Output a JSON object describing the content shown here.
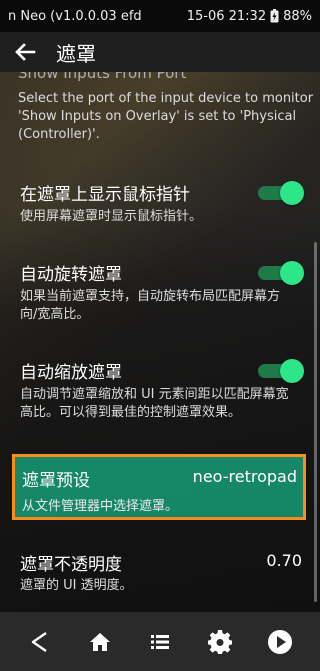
{
  "status_bar": {
    "left_text": "n Neo (v1.0.0.03  efd",
    "time": "15-06 21:32",
    "battery": "88%"
  },
  "header": {
    "title": "遮罩"
  },
  "partial_setting": {
    "title": "Show Inputs From Port",
    "description": "Select the port of the input device to monitor 'Show Inputs on Overlay' is set to 'Physical (Controller)'."
  },
  "settings": [
    {
      "label": "在遮罩上显示鼠标指针",
      "description": "使用屏幕遮罩时显示鼠标指针。",
      "enabled": true
    },
    {
      "label": "自动旋转遮罩",
      "description": "如果当前遮罩支持，自动旋转布局匹配屏幕方向/宽高比。",
      "enabled": true
    },
    {
      "label": "自动缩放遮罩",
      "description": "自动调节遮罩缩放和 UI 元素间距以匹配屏幕宽高比。可以得到最佳的控制遮罩效果。",
      "enabled": true
    }
  ],
  "preset": {
    "label": "遮罩预设",
    "value": "neo-retropad",
    "description": "从文件管理器中选择遮罩。"
  },
  "opacity": {
    "label": "遮罩不透明度",
    "value": "0.70",
    "description": "遮罩的 UI 透明度。"
  },
  "colors": {
    "accent": "#2ee58a",
    "highlight_bg": "#189b78",
    "highlight_border": "#ff8c1a"
  },
  "nav": [
    {
      "icon": "back-icon"
    },
    {
      "icon": "home-icon"
    },
    {
      "icon": "list-icon"
    },
    {
      "icon": "gear-icon"
    },
    {
      "icon": "play-icon"
    }
  ]
}
